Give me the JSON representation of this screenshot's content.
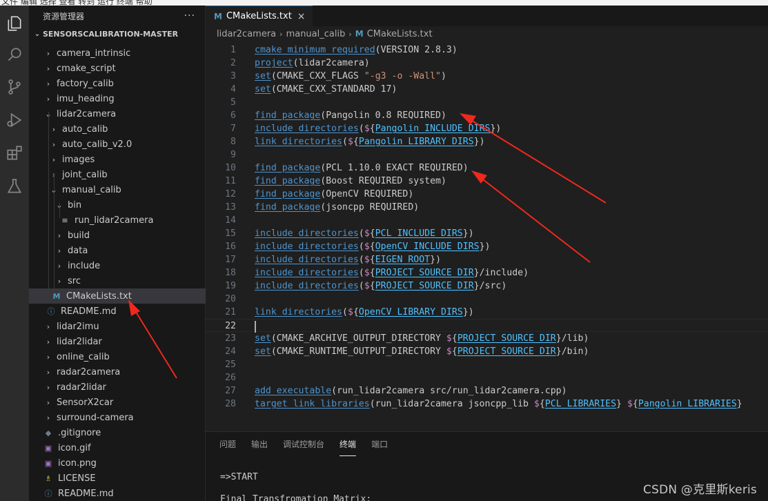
{
  "menubar": {
    "text": "文件  编辑  选择  查看  转到  运行  终端  帮助"
  },
  "sidebar": {
    "title": "资源管理器",
    "more": "···",
    "root": "SENSORSCALIBRATION-MASTER",
    "items": [
      {
        "label": "camera_intrinsic",
        "chev": "›"
      },
      {
        "label": "cmake_script",
        "chev": "›"
      },
      {
        "label": "factory_calib",
        "chev": "›"
      },
      {
        "label": "imu_heading",
        "chev": "›"
      },
      {
        "label": "lidar2camera",
        "chev": "⌄"
      },
      {
        "label": "auto_calib",
        "chev": "›"
      },
      {
        "label": "auto_calib_v2.0",
        "chev": "›"
      },
      {
        "label": "images",
        "chev": "›"
      },
      {
        "label": "joint_calib",
        "chev": "›"
      },
      {
        "label": "manual_calib",
        "chev": "⌄"
      },
      {
        "label": "bin",
        "chev": "⌄"
      },
      {
        "label": "run_lidar2camera",
        "icon": "≡"
      },
      {
        "label": "build",
        "chev": "›"
      },
      {
        "label": "data",
        "chev": "›"
      },
      {
        "label": "include",
        "chev": "›"
      },
      {
        "label": "src",
        "chev": "›"
      },
      {
        "label": "CMakeLists.txt",
        "icon": "M"
      },
      {
        "label": "README.md",
        "icon": "ⓘ"
      },
      {
        "label": "lidar2imu",
        "chev": "›"
      },
      {
        "label": "lidar2lidar",
        "chev": "›"
      },
      {
        "label": "online_calib",
        "chev": "›"
      },
      {
        "label": "radar2camera",
        "chev": "›"
      },
      {
        "label": "radar2lidar",
        "chev": "›"
      },
      {
        "label": "SensorX2car",
        "chev": "›"
      },
      {
        "label": "surround-camera",
        "chev": "›"
      },
      {
        "label": ".gitignore",
        "icon": "◆"
      },
      {
        "label": "icon.gif",
        "icon": "▣"
      },
      {
        "label": "icon.png",
        "icon": "▣"
      },
      {
        "label": "LICENSE",
        "icon": "♗"
      },
      {
        "label": "README.md",
        "icon": "ⓘ"
      }
    ]
  },
  "editor": {
    "tab": {
      "label": "CMakeLists.txt",
      "icon": "M",
      "close": "×"
    },
    "breadcrumb": {
      "part1": "lidar2camera",
      "part2": "manual_calib",
      "file": "CMakeLists.txt",
      "sep": "›"
    },
    "current_line": 22,
    "lines": [
      {
        "n": "1",
        "t": "cmake_minimum_required(VERSION 2.8.3)"
      },
      {
        "n": "2",
        "t": "project(lidar2camera)"
      },
      {
        "n": "3",
        "t": "set(CMAKE_CXX_FLAGS \"-g3 -o -Wall\")"
      },
      {
        "n": "4",
        "t": "set(CMAKE_CXX_STANDARD 17)"
      },
      {
        "n": "5",
        "t": ""
      },
      {
        "n": "6",
        "t": "find_package(Pangolin 0.8 REQUIRED)"
      },
      {
        "n": "7",
        "t": "include_directories(${Pangolin_INCLUDE_DIRS})"
      },
      {
        "n": "8",
        "t": "link_directories(${Pangolin_LIBRARY_DIRS})"
      },
      {
        "n": "9",
        "t": ""
      },
      {
        "n": "10",
        "t": "find_package(PCL 1.10.0 EXACT REQUIRED)"
      },
      {
        "n": "11",
        "t": "find_package(Boost REQUIRED system)"
      },
      {
        "n": "12",
        "t": "find_package(OpenCV REQUIRED)"
      },
      {
        "n": "13",
        "t": "find_package(jsoncpp REQUIRED)"
      },
      {
        "n": "14",
        "t": ""
      },
      {
        "n": "15",
        "t": "include_directories(${PCL_INCLUDE_DIRS})"
      },
      {
        "n": "16",
        "t": "include_directories(${OpenCV_INCLUDE_DIRS})"
      },
      {
        "n": "17",
        "t": "include_directories(${EIGEN_ROOT})"
      },
      {
        "n": "18",
        "t": "include_directories(${PROJECT_SOURCE_DIR}/include)"
      },
      {
        "n": "19",
        "t": "include_directories(${PROJECT_SOURCE_DIR}/src)"
      },
      {
        "n": "20",
        "t": ""
      },
      {
        "n": "21",
        "t": "link_directories(${OpenCV_LIBRARY_DIRS})"
      },
      {
        "n": "22",
        "t": ""
      },
      {
        "n": "23",
        "t": "set(CMAKE_ARCHIVE_OUTPUT_DIRECTORY ${PROJECT_SOURCE_DIR}/lib)"
      },
      {
        "n": "24",
        "t": "set(CMAKE_RUNTIME_OUTPUT_DIRECTORY ${PROJECT_SOURCE_DIR}/bin)"
      },
      {
        "n": "25",
        "t": ""
      },
      {
        "n": "26",
        "t": ""
      },
      {
        "n": "27",
        "t": "add_executable(run_lidar2camera src/run_lidar2camera.cpp)"
      },
      {
        "n": "28",
        "t": "target_link_libraries(run_lidar2camera jsoncpp_lib ${PCL_LIBRARIES} ${Pangolin_LIBRARIES}"
      }
    ]
  },
  "panel": {
    "tabs": [
      "问题",
      "输出",
      "调试控制台",
      "终端",
      "端口"
    ],
    "active_tab": "终端",
    "terminal_lines": [
      "=>START",
      "Final Transfromation Matrix:"
    ]
  },
  "watermark": "CSDN @克里斯keris",
  "colors": {
    "arrow": "#f0281e",
    "accent": "#0078d4",
    "function": "#4e94ce",
    "string": "#ce9178",
    "variable": "#4fc1ff"
  }
}
